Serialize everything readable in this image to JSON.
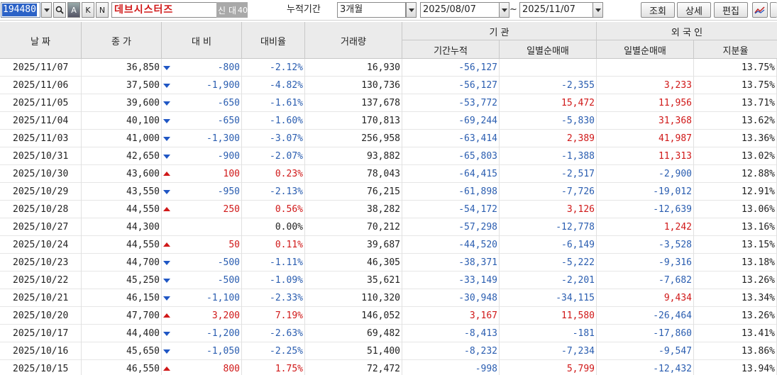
{
  "toolbar": {
    "code": "194480",
    "btn_search": "🔍",
    "btn_a": "A",
    "btn_k": "K",
    "btn_n": "N",
    "stock_name": "데브시스터즈",
    "tag_new": "신",
    "tag_loan": "대",
    "tag_margin": "40",
    "period_label": "누적기간",
    "period_value": "3개월",
    "date_from": "2025/08/07",
    "tilde": "~",
    "date_to": "2025/11/07",
    "btn_query": "조회",
    "btn_detail": "상세",
    "btn_edit": "편집"
  },
  "header": {
    "date": "날 짜",
    "close": "종 가",
    "change": "대 비",
    "change_rate": "대비율",
    "volume": "거래량",
    "institution": "기    관",
    "inst_cumulative": "기간누적",
    "inst_daily": "일별순매매",
    "foreign": "외 국 인",
    "foreign_daily": "일별순매매",
    "foreign_share": "지분율"
  },
  "colors": {
    "up": "#d01818",
    "down": "#2a5db0",
    "header_bg": "#ebebeb"
  },
  "rows": [
    {
      "date": "2025/11/07",
      "close": "36,850",
      "dir": "down",
      "change": "-800",
      "rate": "-2.12%",
      "volume": "16,930",
      "inst_cum": "-56,127",
      "inst_daily": "",
      "frgn_daily": "",
      "frgn_share": "13.75%"
    },
    {
      "date": "2025/11/06",
      "close": "37,500",
      "dir": "down",
      "change": "-1,900",
      "rate": "-4.82%",
      "volume": "130,736",
      "inst_cum": "-56,127",
      "inst_daily": "-2,355",
      "frgn_daily": "3,233",
      "frgn_share": "13.75%"
    },
    {
      "date": "2025/11/05",
      "close": "39,600",
      "dir": "down",
      "change": "-650",
      "rate": "-1.61%",
      "volume": "137,678",
      "inst_cum": "-53,772",
      "inst_daily": "15,472",
      "frgn_daily": "11,956",
      "frgn_share": "13.71%"
    },
    {
      "date": "2025/11/04",
      "close": "40,100",
      "dir": "down",
      "change": "-650",
      "rate": "-1.60%",
      "volume": "170,813",
      "inst_cum": "-69,244",
      "inst_daily": "-5,830",
      "frgn_daily": "31,368",
      "frgn_share": "13.62%"
    },
    {
      "date": "2025/11/03",
      "close": "41,000",
      "dir": "down",
      "change": "-1,300",
      "rate": "-3.07%",
      "volume": "256,958",
      "inst_cum": "-63,414",
      "inst_daily": "2,389",
      "frgn_daily": "41,987",
      "frgn_share": "13.36%"
    },
    {
      "date": "2025/10/31",
      "close": "42,650",
      "dir": "down",
      "change": "-900",
      "rate": "-2.07%",
      "volume": "93,882",
      "inst_cum": "-65,803",
      "inst_daily": "-1,388",
      "frgn_daily": "11,313",
      "frgn_share": "13.02%"
    },
    {
      "date": "2025/10/30",
      "close": "43,600",
      "dir": "up",
      "change": "100",
      "rate": "0.23%",
      "volume": "78,043",
      "inst_cum": "-64,415",
      "inst_daily": "-2,517",
      "frgn_daily": "-2,900",
      "frgn_share": "12.88%"
    },
    {
      "date": "2025/10/29",
      "close": "43,550",
      "dir": "down",
      "change": "-950",
      "rate": "-2.13%",
      "volume": "76,215",
      "inst_cum": "-61,898",
      "inst_daily": "-7,726",
      "frgn_daily": "-19,012",
      "frgn_share": "12.91%"
    },
    {
      "date": "2025/10/28",
      "close": "44,550",
      "dir": "up",
      "change": "250",
      "rate": "0.56%",
      "volume": "38,282",
      "inst_cum": "-54,172",
      "inst_daily": "3,126",
      "frgn_daily": "-12,639",
      "frgn_share": "13.06%"
    },
    {
      "date": "2025/10/27",
      "close": "44,300",
      "dir": "none",
      "change": "",
      "rate": "0.00%",
      "volume": "70,212",
      "inst_cum": "-57,298",
      "inst_daily": "-12,778",
      "frgn_daily": "1,242",
      "frgn_share": "13.16%"
    },
    {
      "date": "2025/10/24",
      "close": "44,550",
      "dir": "up",
      "change": "50",
      "rate": "0.11%",
      "volume": "39,687",
      "inst_cum": "-44,520",
      "inst_daily": "-6,149",
      "frgn_daily": "-3,528",
      "frgn_share": "13.15%"
    },
    {
      "date": "2025/10/23",
      "close": "44,700",
      "dir": "down",
      "change": "-500",
      "rate": "-1.11%",
      "volume": "46,305",
      "inst_cum": "-38,371",
      "inst_daily": "-5,222",
      "frgn_daily": "-9,316",
      "frgn_share": "13.18%"
    },
    {
      "date": "2025/10/22",
      "close": "45,250",
      "dir": "down",
      "change": "-500",
      "rate": "-1.09%",
      "volume": "35,621",
      "inst_cum": "-33,149",
      "inst_daily": "-2,201",
      "frgn_daily": "-7,682",
      "frgn_share": "13.26%"
    },
    {
      "date": "2025/10/21",
      "close": "46,150",
      "dir": "down",
      "change": "-1,100",
      "rate": "-2.33%",
      "volume": "110,320",
      "inst_cum": "-30,948",
      "inst_daily": "-34,115",
      "frgn_daily": "9,434",
      "frgn_share": "13.34%"
    },
    {
      "date": "2025/10/20",
      "close": "47,700",
      "dir": "up",
      "change": "3,200",
      "rate": "7.19%",
      "volume": "146,052",
      "inst_cum": "3,167",
      "inst_daily": "11,580",
      "frgn_daily": "-26,464",
      "frgn_share": "13.26%"
    },
    {
      "date": "2025/10/17",
      "close": "44,400",
      "dir": "down",
      "change": "-1,200",
      "rate": "-2.63%",
      "volume": "69,482",
      "inst_cum": "-8,413",
      "inst_daily": "-181",
      "frgn_daily": "-17,860",
      "frgn_share": "13.41%"
    },
    {
      "date": "2025/10/16",
      "close": "45,650",
      "dir": "down",
      "change": "-1,050",
      "rate": "-2.25%",
      "volume": "51,400",
      "inst_cum": "-8,232",
      "inst_daily": "-7,234",
      "frgn_daily": "-9,547",
      "frgn_share": "13.86%"
    },
    {
      "date": "2025/10/15",
      "close": "46,550",
      "dir": "up",
      "change": "800",
      "rate": "1.75%",
      "volume": "72,472",
      "inst_cum": "-998",
      "inst_daily": "5,799",
      "frgn_daily": "-12,432",
      "frgn_share": "13.94%"
    }
  ]
}
